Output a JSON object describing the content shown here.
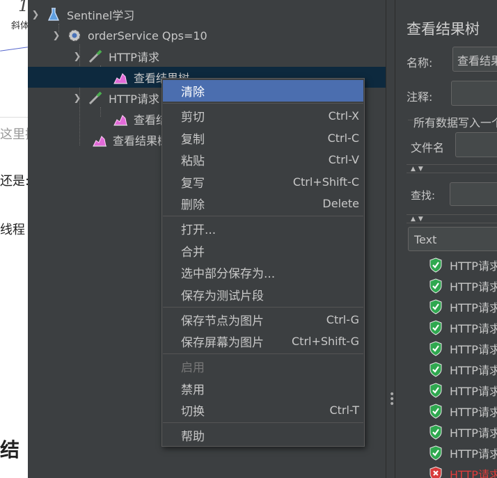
{
  "background_doc": {
    "fragments": [
      "1",
      "斜体",
      "这里插",
      "还是:",
      "线程",
      "结"
    ]
  },
  "tree": {
    "nodes": [
      {
        "label": "Sentinel学习",
        "icon": "flask-icon"
      },
      {
        "label": "orderService Qps=10",
        "icon": "gear-icon"
      },
      {
        "label": "HTTP请求",
        "icon": "pipette-icon"
      },
      {
        "label": "查看结果树",
        "icon": "graph-icon"
      },
      {
        "label": "HTTP请求",
        "icon": "pipette-icon"
      },
      {
        "label": "查看结果树",
        "icon": "graph-icon"
      },
      {
        "label": "查看结果树",
        "icon": "graph-icon"
      }
    ]
  },
  "context_menu": {
    "items": [
      {
        "label": "清除",
        "shortcut": ""
      },
      {
        "label": "剪切",
        "shortcut": "Ctrl-X"
      },
      {
        "label": "复制",
        "shortcut": "Ctrl-C"
      },
      {
        "label": "粘贴",
        "shortcut": "Ctrl-V"
      },
      {
        "label": "复写",
        "shortcut": "Ctrl+Shift-C"
      },
      {
        "label": "删除",
        "shortcut": "Delete"
      },
      {
        "label": "打开...",
        "shortcut": ""
      },
      {
        "label": "合并",
        "shortcut": ""
      },
      {
        "label": "选中部分保存为...",
        "shortcut": ""
      },
      {
        "label": "保存为测试片段",
        "shortcut": ""
      },
      {
        "label": "保存节点为图片",
        "shortcut": "Ctrl-G"
      },
      {
        "label": "保存屏幕为图片",
        "shortcut": "Ctrl+Shift-G"
      },
      {
        "label": "启用",
        "shortcut": ""
      },
      {
        "label": "禁用",
        "shortcut": ""
      },
      {
        "label": "切换",
        "shortcut": "Ctrl-T"
      },
      {
        "label": "帮助",
        "shortcut": ""
      }
    ]
  },
  "results_panel": {
    "title": "查看结果树",
    "name_label": "名称:",
    "name_value": "查看结果树",
    "comment_label": "注释:",
    "write_all_label": "所有数据写入一个文件",
    "filename_label": "文件名",
    "search_label": "查找:",
    "renderer_value": "Text",
    "results": [
      {
        "label": "HTTP请求",
        "status": "success"
      },
      {
        "label": "HTTP请求",
        "status": "success"
      },
      {
        "label": "HTTP请求",
        "status": "success"
      },
      {
        "label": "HTTP请求",
        "status": "success"
      },
      {
        "label": "HTTP请求",
        "status": "success"
      },
      {
        "label": "HTTP请求",
        "status": "success"
      },
      {
        "label": "HTTP请求",
        "status": "success"
      },
      {
        "label": "HTTP请求",
        "status": "success"
      },
      {
        "label": "HTTP请求",
        "status": "success"
      },
      {
        "label": "HTTP请求",
        "status": "success"
      },
      {
        "label": "HTTP请求",
        "status": "failure"
      }
    ]
  },
  "colors": {
    "panel_bg": "#3c3f41",
    "menu_highlight": "#4b6eaf",
    "selection": "#0d293e",
    "success": "#2fa84f",
    "failure": "#d83a3a"
  }
}
